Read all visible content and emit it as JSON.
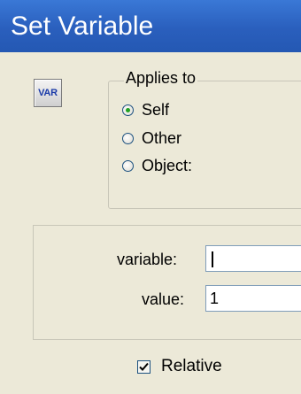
{
  "window": {
    "title": "Set Variable"
  },
  "icon": {
    "label": "VAR",
    "name": "var-icon"
  },
  "applies_to": {
    "legend": "Applies to",
    "options": [
      {
        "label": "Self",
        "checked": true
      },
      {
        "label": "Other",
        "checked": false
      },
      {
        "label": "Object:",
        "checked": false
      }
    ]
  },
  "fields": {
    "variable": {
      "label": "variable:",
      "value": ""
    },
    "value": {
      "label": "value:",
      "value": "1"
    }
  },
  "relative": {
    "label": "Relative",
    "checked": true
  }
}
